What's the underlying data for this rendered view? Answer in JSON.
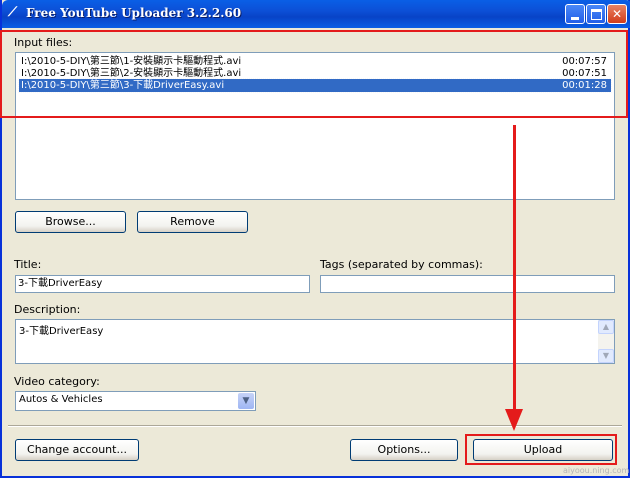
{
  "window": {
    "title": "Free YouTube Uploader 3.2.2.60",
    "icon": "app-icon",
    "accent_color": "#0a5fe6"
  },
  "input_files": {
    "label": "Input files:",
    "files": [
      {
        "path": "I:\\2010-5-DIY\\第三節\\1-安裝顯示卡驅動程式.avi",
        "duration": "00:07:57",
        "selected": false
      },
      {
        "path": "I:\\2010-5-DIY\\第三節\\2-安裝顯示卡驅動程式.avi",
        "duration": "00:07:51",
        "selected": false
      },
      {
        "path": "I:\\2010-5-DIY\\第三節\\3-下載DriverEasy.avi",
        "duration": "00:01:28",
        "selected": true
      }
    ]
  },
  "buttons": {
    "browse": "Browse...",
    "remove": "Remove",
    "change_account": "Change account...",
    "options": "Options...",
    "upload": "Upload"
  },
  "title_field": {
    "label": "Title:",
    "value": "3-下載DriverEasy"
  },
  "tags_field": {
    "label": "Tags (separated by commas):",
    "value": ""
  },
  "description": {
    "label": "Description:",
    "value": "3-下載DriverEasy"
  },
  "category": {
    "label": "Video category:",
    "value": "Autos & Vehicles"
  },
  "annotation": {
    "color": "#e41b1b"
  },
  "watermark": "aiyoou.ning.com"
}
